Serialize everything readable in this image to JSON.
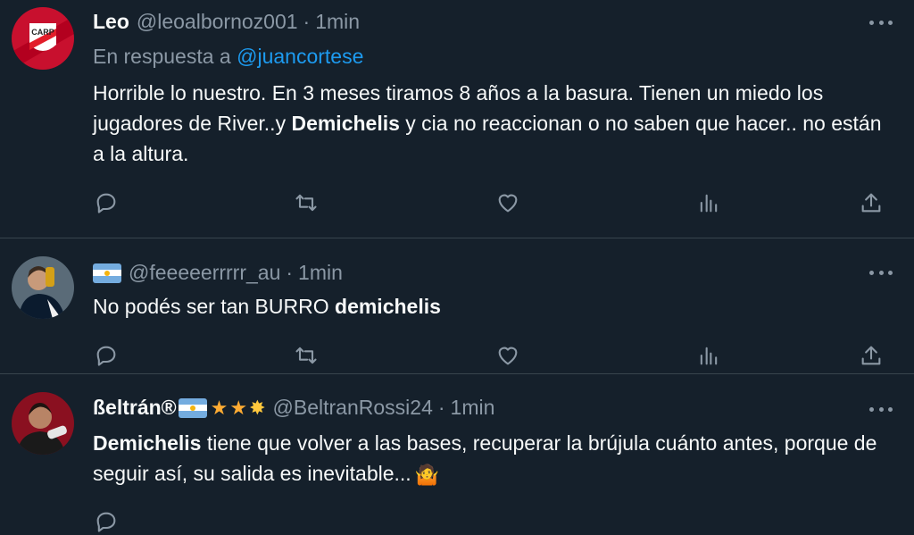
{
  "tweets": [
    {
      "name": "Leo",
      "handle": "@leoalbornoz001",
      "dot": "·",
      "time": "1min",
      "reply_prefix": "En respuesta a",
      "reply_to": "@juancortese",
      "text_parts": [
        "Horrible lo nuestro. En 3 meses tiramos 8 años a la basura. Tienen un miedo los jugadores de River..y ",
        "Demichelis",
        " y cia no reaccionan o no saben que hacer.. no están a la altura."
      ],
      "avatar_icon": "river-plate-crest-avatar"
    },
    {
      "name": "",
      "handle": "@feeeeerrrrr_au",
      "dot": "·",
      "time": "1min",
      "text_parts": [
        "No podés ser tan BURRO ",
        "demichelis",
        ""
      ],
      "avatar_icon": "messi-trophy-avatar"
    },
    {
      "name": "ßeltrán®",
      "handle": "@BeltranRossi24",
      "dot": "·",
      "time": "1min",
      "text_parts": [
        "Demichelis",
        " tiene que volver a las bases, recuperar la brújula cuánto antes, porque de seguir así, su salida es inevitable..."
      ],
      "avatar_icon": "player-avatar"
    }
  ],
  "actions": [
    "reply-icon",
    "retweet-icon",
    "like-icon",
    "views-icon",
    "share-icon"
  ],
  "colors": {
    "background": "#15202b",
    "text": "#f7f9f9",
    "muted": "#8b98a5",
    "link": "#1d9bf0",
    "divider": "#38444d"
  }
}
